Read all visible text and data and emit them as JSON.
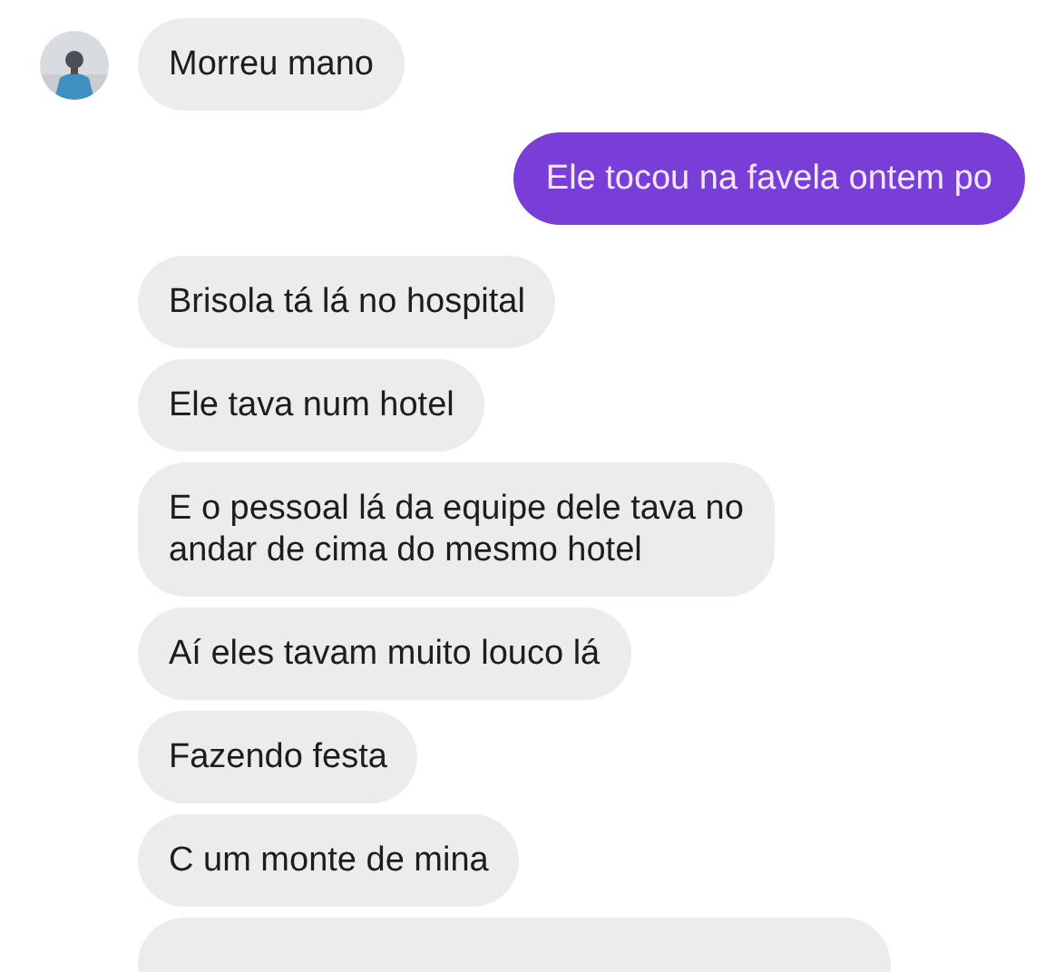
{
  "messages": [
    {
      "kind": "received",
      "show_avatar": true,
      "text": "Morreu mano"
    },
    {
      "kind": "sent",
      "text": "Ele tocou na favela ontem po"
    },
    {
      "kind": "received",
      "show_avatar": false,
      "text": "Brisola tá lá no hospital"
    },
    {
      "kind": "received",
      "show_avatar": false,
      "text": "Ele tava num hotel"
    },
    {
      "kind": "received",
      "show_avatar": false,
      "text": "E o pessoal lá da equipe dele tava no\nandar de cima do mesmo hotel"
    },
    {
      "kind": "received",
      "show_avatar": false,
      "text": "Aí eles tavam muito louco lá"
    },
    {
      "kind": "received",
      "show_avatar": false,
      "text": "Fazendo festa"
    },
    {
      "kind": "received",
      "show_avatar": false,
      "text": "C um monte de mina"
    },
    {
      "kind": "cut_off"
    }
  ]
}
